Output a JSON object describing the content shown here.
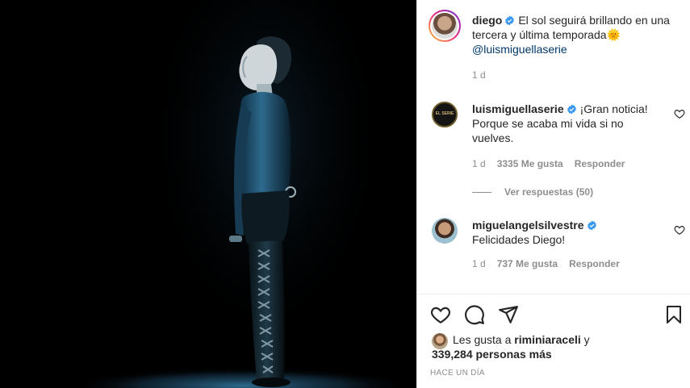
{
  "post": {
    "author": "diego",
    "caption": "El sol seguirá brillando en una tercera y última temporada",
    "caption_emoji": "🌞",
    "mention": "@luismiguellaserie",
    "time": "1 d"
  },
  "comments": [
    {
      "user": "luismiguellaserie",
      "avatar_text": "EL SERIE",
      "text": "¡Gran noticia! Porque se acaba mi vida si no vuelves.",
      "time": "1 d",
      "likes": "3335 Me gusta",
      "reply": "Responder",
      "view_replies": "Ver respuestas (50)"
    },
    {
      "user": "miguelangelsilvestre",
      "text": "Felicidades Diego!",
      "time": "1 d",
      "likes": "737 Me gusta",
      "reply": "Responder"
    }
  ],
  "likes": {
    "prefix": "Les gusta a",
    "user": "riminiaraceli",
    "suffix": "y",
    "count": "339,284 personas más"
  },
  "posted_ago": "HACE UN DÍA",
  "icons": {
    "like": "heart-icon",
    "comment": "comment-icon",
    "share": "paper-plane-icon",
    "save": "bookmark-icon",
    "verified": "verified-badge-icon"
  },
  "colors": {
    "verified": "#3897f0",
    "mention": "#00376b",
    "muted": "#8e8e8e"
  }
}
